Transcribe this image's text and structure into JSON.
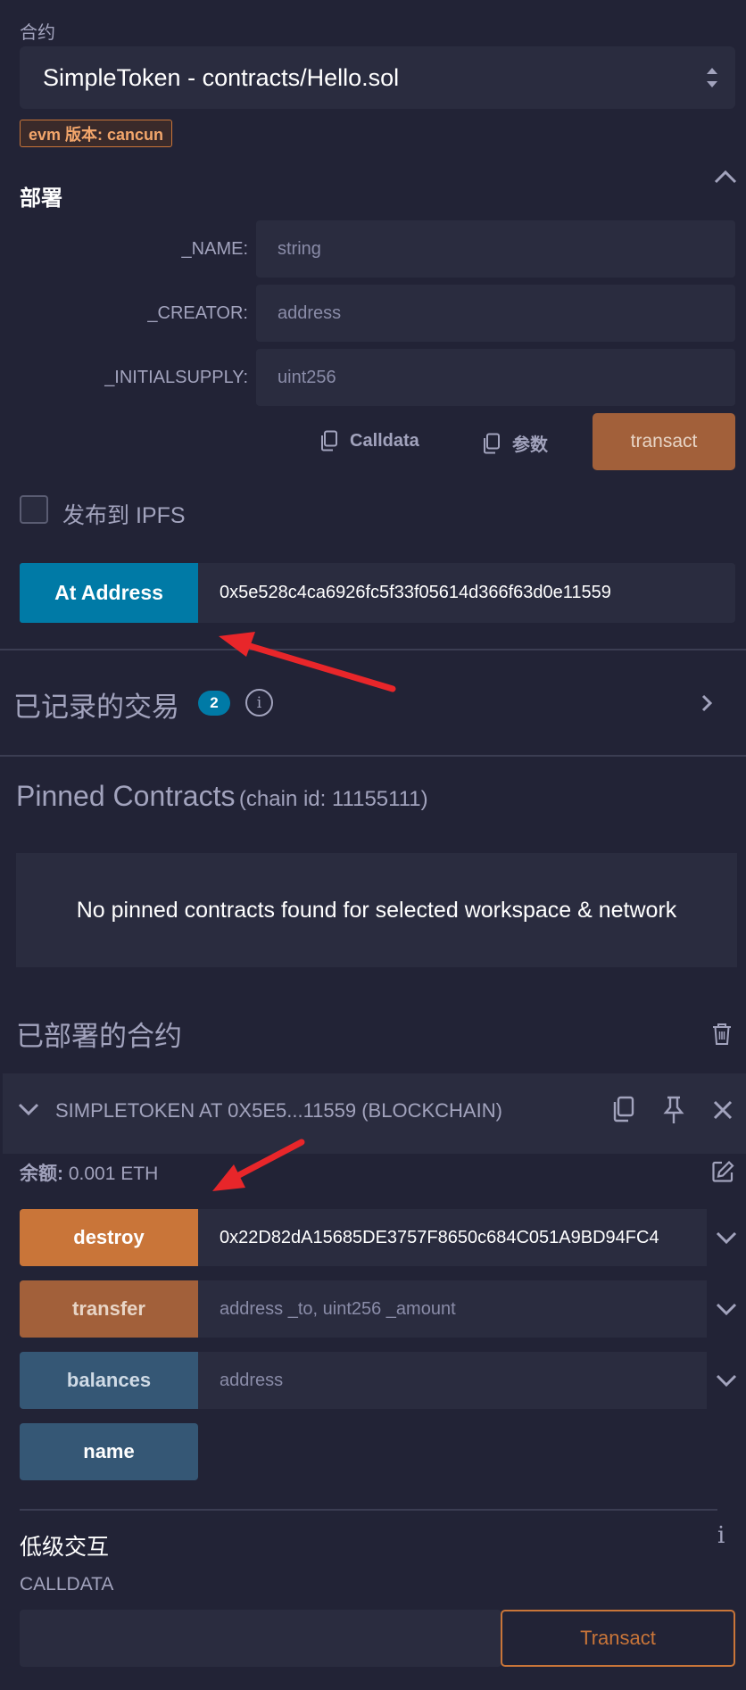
{
  "contract": {
    "label": "合约",
    "selected": "SimpleToken - contracts/Hello.sol",
    "evm_badge": "evm 版本: cancun"
  },
  "deploy": {
    "title": "部署",
    "params": [
      {
        "label": "_NAME:",
        "placeholder": "string"
      },
      {
        "label": "_CREATOR:",
        "placeholder": "address"
      },
      {
        "label": "_INITIALSUPPLY:",
        "placeholder": "uint256"
      }
    ],
    "calldata_label": "Calldata",
    "params_label": "参数",
    "transact_label": "transact",
    "ipfs_label": "发布到 IPFS"
  },
  "at_address": {
    "button_label": "At Address",
    "value": "0x5e528c4ca6926fc5f33f05614d366f63d0e11559"
  },
  "recorded": {
    "title": "已记录的交易",
    "count": "2",
    "info_glyph": "i"
  },
  "pinned": {
    "title": "Pinned Contracts",
    "chain": "(chain id: 11155111)",
    "empty_message": "No pinned contracts found for selected workspace & network"
  },
  "deployed": {
    "title": "已部署的合约",
    "instance": {
      "name": "SIMPLETOKEN AT 0X5E5...11559 (BLOCKCHAIN)",
      "balance_label": "余额:",
      "balance_value": "0.001 ETH",
      "functions": [
        {
          "label": "destroy",
          "value": "0x22D82dA15685DE3757F8650c684C051A9BD94FC4",
          "placeholder": "",
          "kind": "payable"
        },
        {
          "label": "transfer",
          "value": "",
          "placeholder": "address _to, uint256 _amount",
          "kind": "nonpayable"
        },
        {
          "label": "balances",
          "value": "",
          "placeholder": "address",
          "kind": "view"
        },
        {
          "label": "name",
          "value": "",
          "placeholder": "",
          "kind": "view"
        }
      ],
      "low_level": {
        "title": "低级交互",
        "calldata_label": "CALLDATA",
        "transact_label": "Transact",
        "info_glyph": "i"
      }
    }
  },
  "colors": {
    "background": "#222336",
    "panel": "#2a2c3f",
    "accent_blue": "#007aa6",
    "payable": "#c97539",
    "nonpayable": "#a2603a",
    "view": "#355775",
    "annotation_arrow": "#e8262a"
  }
}
